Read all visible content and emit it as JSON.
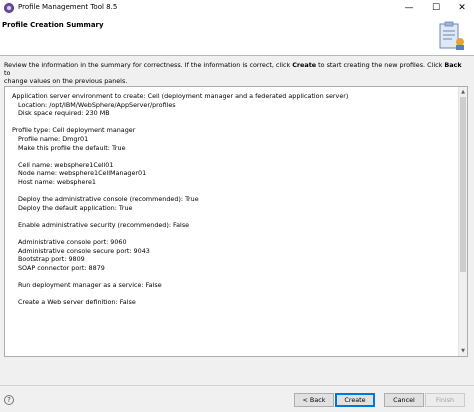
{
  "window": {
    "title": "Profile Management Tool 8.5",
    "minimize_glyph": "—",
    "maximize_glyph": "☐",
    "close_glyph": "✕"
  },
  "header": {
    "title": "Profile Creation Summary",
    "icon": "wizard-clipboard-icon"
  },
  "instructions": {
    "part1": "Review the information in the summary for correctness. If the information is correct, click ",
    "create_word": "Create",
    "part2": " to start creating the new profiles. Click ",
    "back_word": "Back",
    "part3": " to",
    "line2": "change values on the previous panels."
  },
  "summary": {
    "lines": [
      "Application server environment to create: Cell (deployment manager and a federated application server)",
      "Location: /opt/IBM/WebSphere/AppServer/profiles",
      "Disk space required: 230 MB",
      "",
      "Profile type: Cell deployment manager",
      "Profile name: Dmgr01",
      "Make this profile the default: True",
      "",
      "Cell name: websphere1Cell01",
      "Node name: websphere1CellManager01",
      "Host name: websphere1",
      "",
      "Deploy the administrative console (recommended): True",
      "Deploy the default application: True",
      "",
      "Enable administrative security (recommended): False",
      "",
      "Administrative console port: 9060",
      "Administrative console secure port: 9043",
      "Bootstrap port: 9809",
      "SOAP connector port: 8879",
      "",
      "Run deployment manager as a service: False",
      "",
      "Create a Web server definition: False"
    ]
  },
  "buttons": {
    "back": "< Back",
    "create": "Create",
    "cancel": "Cancel",
    "finish": "Finish"
  },
  "help_glyph": "?"
}
